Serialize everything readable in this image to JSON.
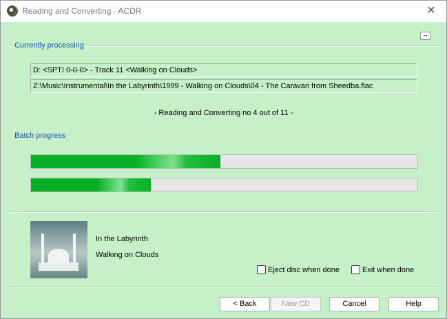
{
  "window": {
    "title": "Reading and Converting - ACDR",
    "close_glyph": "✕",
    "app_icon": "cd-disc-icon"
  },
  "collapse_button": {
    "label": "--"
  },
  "current": {
    "section_label": "Currently processing",
    "drive_line": "D: <SPTI 0-0-0>  - Track 11 <Walking on Clouds>",
    "file_line": "Z:\\Music\\Instrumental\\In the Labyrinth\\1999 - Walking on Clouds\\04 - The Caravan from Sheedba.flac",
    "status": "- Reading and Converting no 4 out of 11 -"
  },
  "batch": {
    "section_label": "Batch progress",
    "track_progress": 0.49,
    "batch_progress": 0.31
  },
  "album": {
    "artist": "In the Labyrinth",
    "title": "Walking on Clouds"
  },
  "options": {
    "eject_label": "Eject disc when done",
    "eject_checked": false,
    "exit_label": "Exit when done",
    "exit_checked": false
  },
  "buttons": {
    "back": "< Back",
    "new_cd": "New CD",
    "cancel": "Cancel",
    "help": "Help"
  },
  "colors": {
    "progress": "#06b025",
    "section_label": "#1a4fb0",
    "background": "#c6f0c8"
  }
}
